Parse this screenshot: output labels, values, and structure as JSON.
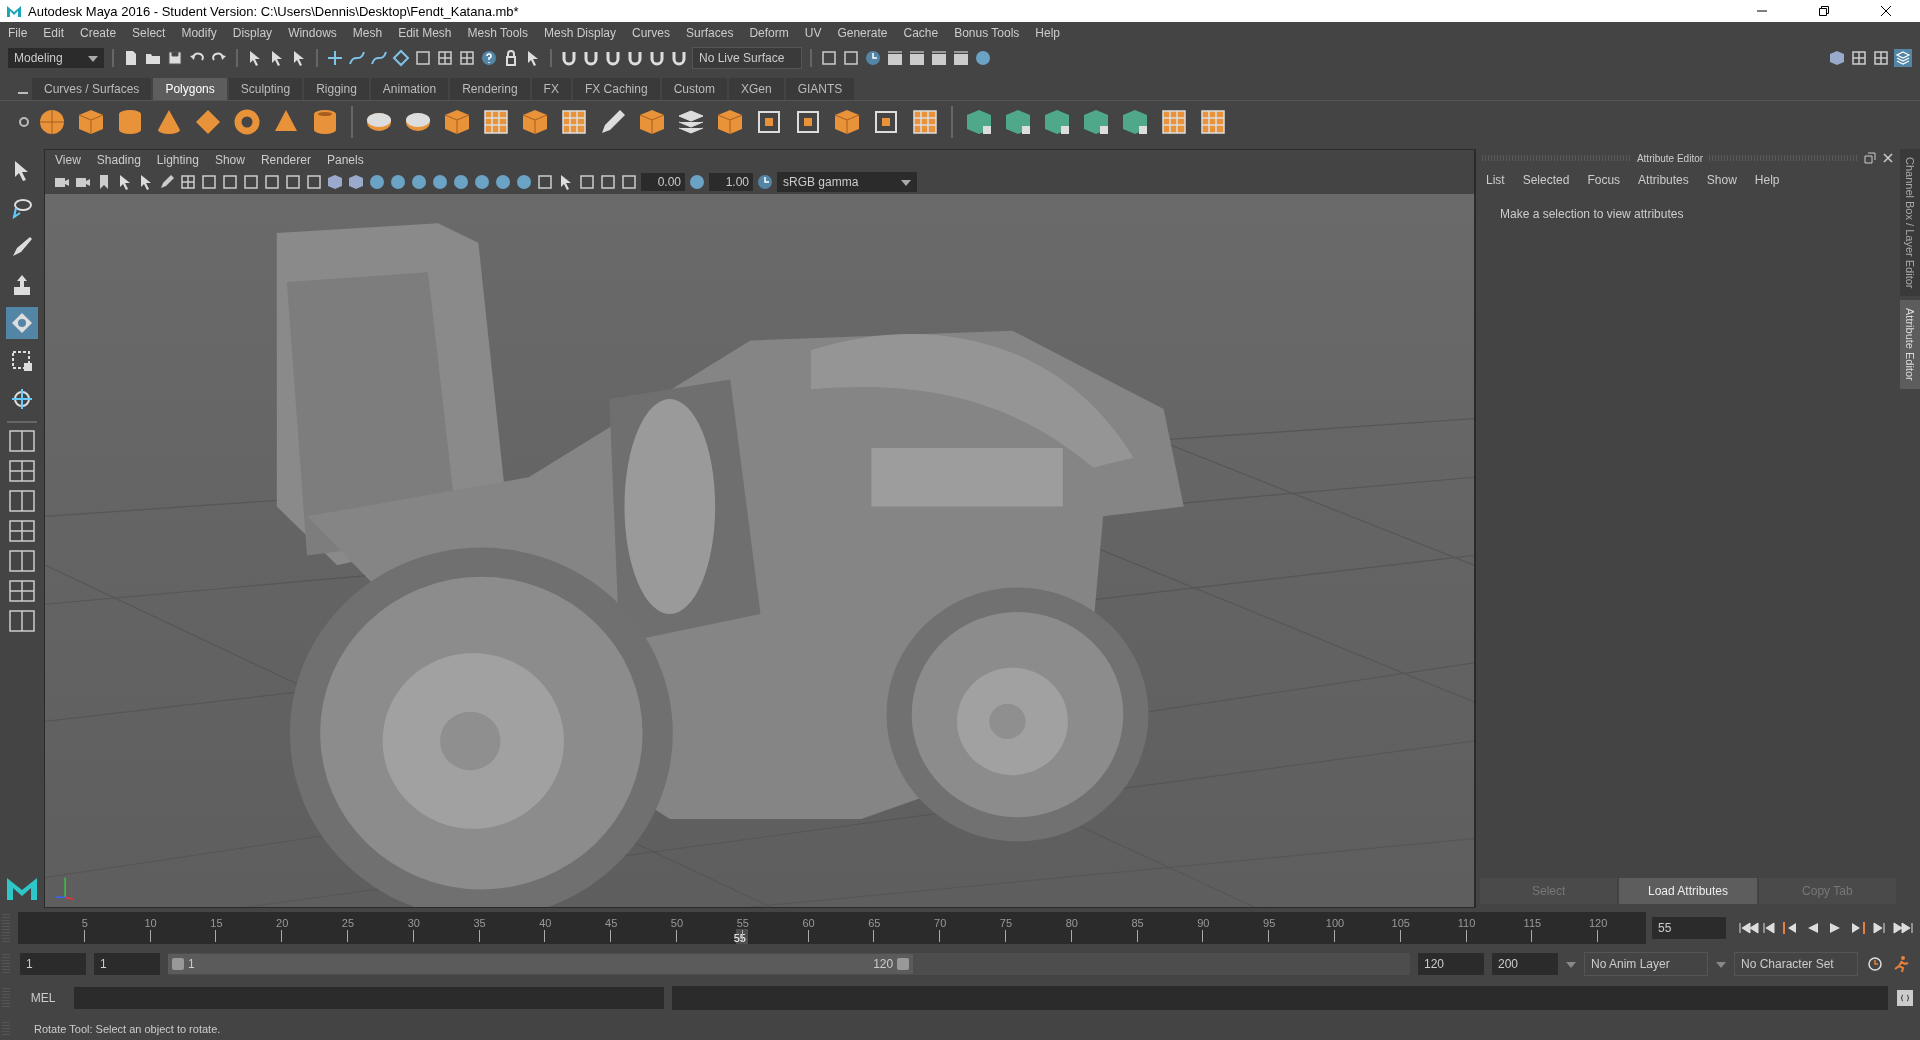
{
  "window": {
    "title": "Autodesk Maya 2016 - Student Version: C:\\Users\\Dennis\\Desktop\\Fendt_Katana.mb*"
  },
  "menu_bar": [
    "File",
    "Edit",
    "Create",
    "Select",
    "Modify",
    "Display",
    "Windows",
    "Mesh",
    "Edit Mesh",
    "Mesh Tools",
    "Mesh Display",
    "Curves",
    "Surfaces",
    "Deform",
    "UV",
    "Generate",
    "Cache",
    "Bonus Tools",
    "Help"
  ],
  "status_line": {
    "workspace": "Modeling",
    "live_surface": "No Live Surface"
  },
  "shelf": {
    "tabs": [
      {
        "label": "Curves / Surfaces",
        "selected": false
      },
      {
        "label": "Polygons",
        "selected": true
      },
      {
        "label": "Sculpting",
        "selected": false
      },
      {
        "label": "Rigging",
        "selected": false
      },
      {
        "label": "Animation",
        "selected": false
      },
      {
        "label": "Rendering",
        "selected": false
      },
      {
        "label": "FX",
        "selected": false
      },
      {
        "label": "FX Caching",
        "selected": false
      },
      {
        "label": "Custom",
        "selected": false
      },
      {
        "label": "XGen",
        "selected": false
      },
      {
        "label": "GIANTS",
        "selected": false
      }
    ]
  },
  "toolbox": [
    {
      "kind": "select",
      "selected": false
    },
    {
      "kind": "lasso",
      "selected": false
    },
    {
      "kind": "paint",
      "selected": false
    },
    {
      "kind": "move",
      "selected": false
    },
    {
      "kind": "rotate",
      "selected": true
    },
    {
      "kind": "scale",
      "selected": false
    },
    {
      "kind": "universal",
      "selected": false
    }
  ],
  "viewport": {
    "menus": [
      "View",
      "Shading",
      "Lighting",
      "Show",
      "Renderer",
      "Panels"
    ],
    "exposure": "0.00",
    "gamma": "1.00",
    "color_space": "sRGB gamma"
  },
  "attribute_editor": {
    "title": "Attribute Editor",
    "menus": [
      "List",
      "Selected",
      "Focus",
      "Attributes",
      "Show",
      "Help"
    ],
    "message": "Make a selection to view attributes",
    "buttons": [
      {
        "label": "Select",
        "disabled": true
      },
      {
        "label": "Load Attributes",
        "disabled": false
      },
      {
        "label": "Copy Tab",
        "disabled": true
      }
    ]
  },
  "side_tabs": [
    {
      "label": "Channel Box / Layer Editor",
      "selected": false
    },
    {
      "label": "Attribute Editor",
      "selected": true
    }
  ],
  "time_slider": {
    "ticks": [
      "5",
      "10",
      "15",
      "20",
      "25",
      "30",
      "35",
      "40",
      "45",
      "50",
      "55",
      "60",
      "65",
      "70",
      "75",
      "80",
      "85",
      "90",
      "95",
      "100",
      "105",
      "110",
      "115",
      "120"
    ],
    "level": 0.4583,
    "current_frame": "55",
    "current_frame_field": "55"
  },
  "range_slider": {
    "level": 0.6,
    "start_time": "1",
    "playback_start": "1",
    "range_start": "1",
    "range_end": "120",
    "playback_end": "120",
    "end_time": "200",
    "anim_layer": "No Anim Layer",
    "character_set": "No Character Set"
  },
  "command_line": {
    "label": "MEL"
  },
  "help_line": "Rotate Tool: Select an object to rotate."
}
